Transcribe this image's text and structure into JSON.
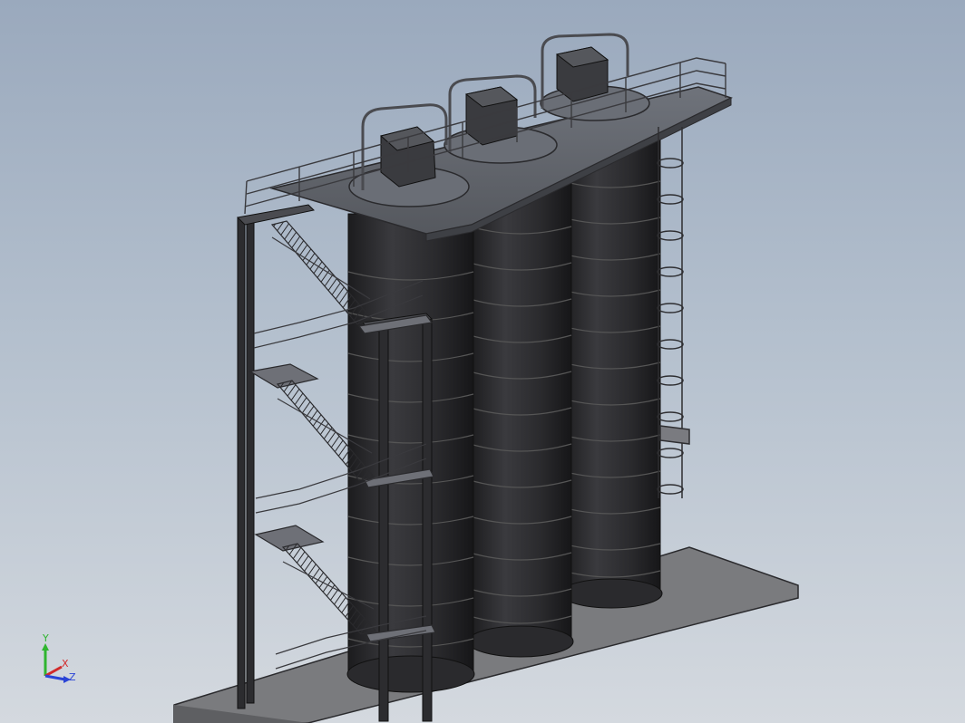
{
  "viewport": {
    "background_top": "#9aa9bd",
    "background_bottom": "#d4d9df"
  },
  "model": {
    "silo_count": 3,
    "stair_levels": 3,
    "tank_color": "#2b2b2e",
    "rail_color": "#3a3a3e",
    "floor_color": "#77777a"
  },
  "triad": {
    "y_label": "Y",
    "x_label": "X",
    "z_label": "Z",
    "y_color": "#2fb52f",
    "x_color": "#d22a2a",
    "z_color": "#2a44d6"
  }
}
